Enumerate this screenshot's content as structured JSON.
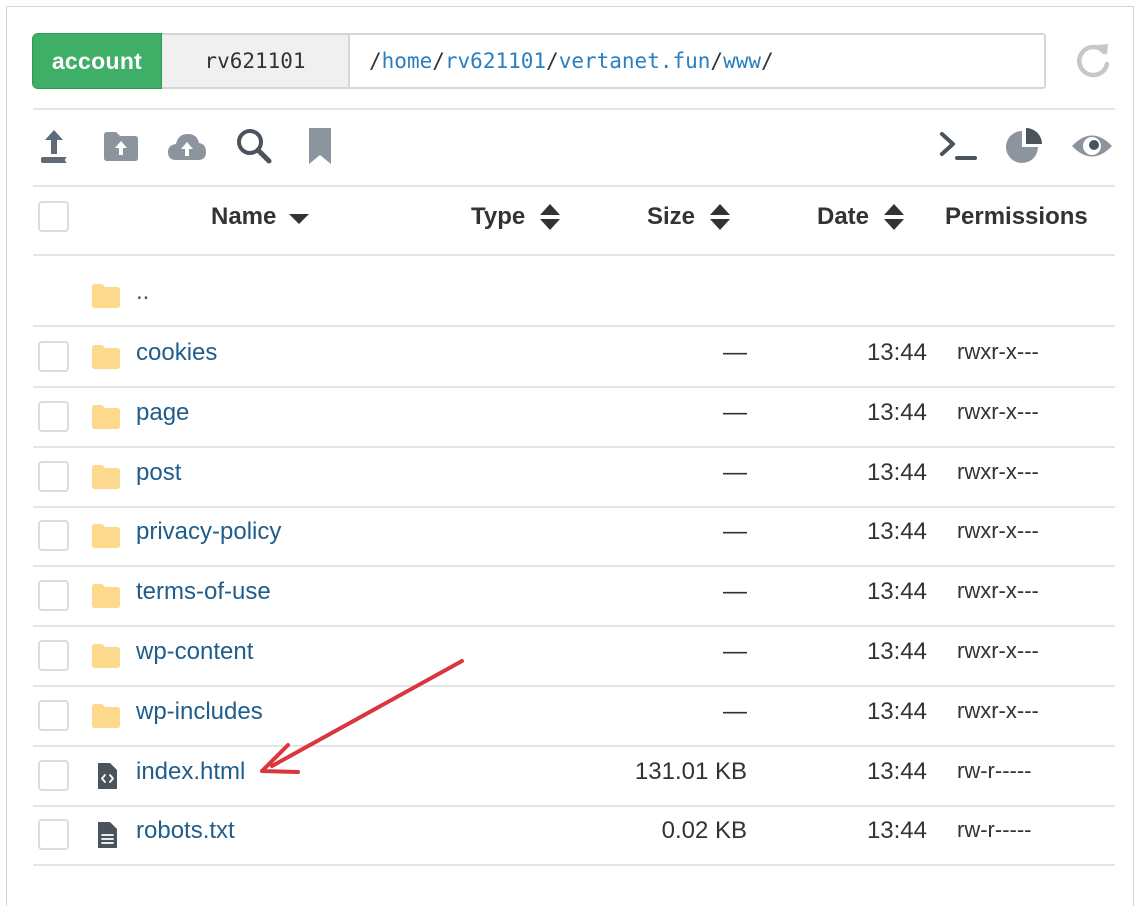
{
  "path_bar": {
    "account_label": "account",
    "user": "rv621101",
    "segments": [
      "home",
      "rv621101",
      "vertanet.fun",
      "www"
    ]
  },
  "toolbar": {
    "left_icons": [
      "upload-file-icon",
      "upload-folder-icon",
      "cloud-upload-icon",
      "search-icon",
      "bookmark-icon"
    ],
    "right_icons": [
      "terminal-icon",
      "pie-chart-icon",
      "eye-icon"
    ]
  },
  "table": {
    "headers": {
      "name": "Name",
      "type": "Type",
      "size": "Size",
      "date": "Date",
      "permissions": "Permissions"
    },
    "parent_label": "..",
    "rows": [
      {
        "name": "cookies",
        "kind": "folder",
        "size": "—",
        "date": "13:44",
        "perm": "rwxr-x---"
      },
      {
        "name": "page",
        "kind": "folder",
        "size": "—",
        "date": "13:44",
        "perm": "rwxr-x---"
      },
      {
        "name": "post",
        "kind": "folder",
        "size": "—",
        "date": "13:44",
        "perm": "rwxr-x---"
      },
      {
        "name": "privacy-policy",
        "kind": "folder",
        "size": "—",
        "date": "13:44",
        "perm": "rwxr-x---"
      },
      {
        "name": "terms-of-use",
        "kind": "folder",
        "size": "—",
        "date": "13:44",
        "perm": "rwxr-x---"
      },
      {
        "name": "wp-content",
        "kind": "folder",
        "size": "—",
        "date": "13:44",
        "perm": "rwxr-x---"
      },
      {
        "name": "wp-includes",
        "kind": "folder",
        "size": "—",
        "date": "13:44",
        "perm": "rwxr-x---"
      },
      {
        "name": "index.html",
        "kind": "code-file",
        "size": "131.01 KB",
        "date": "13:44",
        "perm": "rw-r-----"
      },
      {
        "name": "robots.txt",
        "kind": "text-file",
        "size": "0.02 KB",
        "date": "13:44",
        "perm": "rw-r-----"
      }
    ]
  },
  "colors": {
    "account_badge": "#3fae66",
    "link": "#1f5d8c",
    "path_link": "#2a7fc1",
    "folder": "#fcd98c",
    "annotation_arrow": "#d9363e"
  }
}
